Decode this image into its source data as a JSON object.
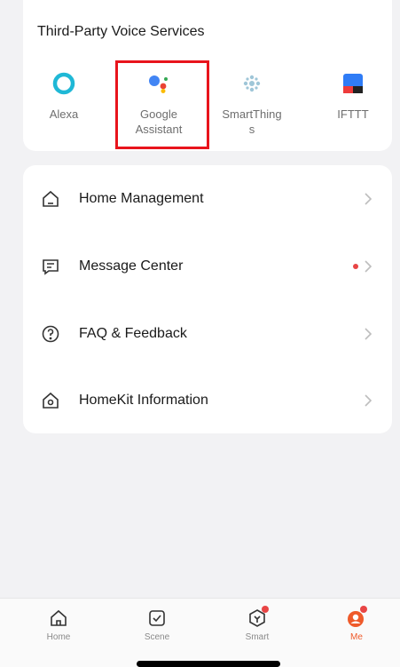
{
  "voice_services": {
    "title": "Third-Party Voice Services",
    "items": [
      {
        "label": "Alexa",
        "icon": "alexa-icon"
      },
      {
        "label": "Google Assistant",
        "icon": "google-assistant-icon"
      },
      {
        "label": "SmartThings",
        "icon": "smartthings-icon"
      },
      {
        "label": "IFTTT",
        "icon": "ifttt-icon"
      }
    ]
  },
  "menu": {
    "items": [
      {
        "label": "Home Management",
        "icon": "house-icon"
      },
      {
        "label": "Message Center",
        "icon": "message-icon"
      },
      {
        "label": "FAQ & Feedback",
        "icon": "question-icon"
      },
      {
        "label": "HomeKit Information",
        "icon": "homekit-icon"
      }
    ]
  },
  "tabbar": {
    "tabs": [
      {
        "label": "Home",
        "icon": "home-tab-icon"
      },
      {
        "label": "Scene",
        "icon": "scene-tab-icon"
      },
      {
        "label": "Smart",
        "icon": "smart-tab-icon"
      },
      {
        "label": "Me",
        "icon": "me-tab-icon"
      }
    ],
    "active": "Me"
  },
  "colors": {
    "accent": "#ef5a2a",
    "highlight": "#e8141c",
    "badge": "#e84545",
    "alexa": "#1fb8d6",
    "ifttt_blue": "#2f7cf6"
  }
}
